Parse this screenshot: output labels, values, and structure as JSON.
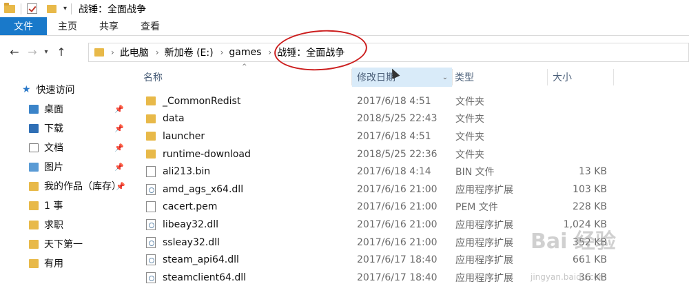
{
  "window": {
    "title": "战锤：全面战争"
  },
  "ribbon": {
    "tabs": [
      "文件",
      "主页",
      "共享",
      "查看"
    ]
  },
  "address": {
    "crumbs": [
      "此电脑",
      "新加卷 (E:)",
      "games",
      "战锤：全面战争"
    ]
  },
  "sidebar": {
    "items": [
      {
        "label": "快速访问",
        "icon": "star-icon"
      },
      {
        "label": "桌面",
        "icon": "desktop-icon",
        "pinned": true
      },
      {
        "label": "下载",
        "icon": "download-icon",
        "pinned": true
      },
      {
        "label": "文档",
        "icon": "document-icon",
        "pinned": true
      },
      {
        "label": "图片",
        "icon": "picture-icon",
        "pinned": true
      },
      {
        "label": "我的作品（库存）",
        "icon": "folder-icon",
        "pinned": true
      },
      {
        "label": "1 事",
        "icon": "folder-icon"
      },
      {
        "label": "求职",
        "icon": "folder-icon"
      },
      {
        "label": "天下第一",
        "icon": "folder-icon"
      },
      {
        "label": "有用",
        "icon": "folder-icon"
      }
    ]
  },
  "columns": {
    "name": "名称",
    "date": "修改日期",
    "type": "类型",
    "size": "大小"
  },
  "files": [
    {
      "name": "_CommonRedist",
      "date": "2017/6/18 4:51",
      "type": "文件夹",
      "size": "",
      "icon": "folder"
    },
    {
      "name": "data",
      "date": "2018/5/25 22:43",
      "type": "文件夹",
      "size": "",
      "icon": "folder"
    },
    {
      "name": "launcher",
      "date": "2017/6/18 4:51",
      "type": "文件夹",
      "size": "",
      "icon": "folder"
    },
    {
      "name": "runtime-download",
      "date": "2018/5/25 22:36",
      "type": "文件夹",
      "size": "",
      "icon": "folder"
    },
    {
      "name": "ali213.bin",
      "date": "2017/6/18 4:14",
      "type": "BIN 文件",
      "size": "13 KB",
      "icon": "doc"
    },
    {
      "name": "amd_ags_x64.dll",
      "date": "2017/6/16 21:00",
      "type": "应用程序扩展",
      "size": "103 KB",
      "icon": "dll"
    },
    {
      "name": "cacert.pem",
      "date": "2017/6/16 21:00",
      "type": "PEM 文件",
      "size": "228 KB",
      "icon": "doc"
    },
    {
      "name": "libeay32.dll",
      "date": "2017/6/16 21:00",
      "type": "应用程序扩展",
      "size": "1,024 KB",
      "icon": "dll"
    },
    {
      "name": "ssleay32.dll",
      "date": "2017/6/16 21:00",
      "type": "应用程序扩展",
      "size": "352 KB",
      "icon": "dll"
    },
    {
      "name": "steam_api64.dll",
      "date": "2017/6/17 18:40",
      "type": "应用程序扩展",
      "size": "661 KB",
      "icon": "dll"
    },
    {
      "name": "steamclient64.dll",
      "date": "2017/6/17 18:40",
      "type": "应用程序扩展",
      "size": "36 KB",
      "icon": "dll"
    }
  ],
  "watermark": {
    "text": "Bai 经验",
    "sub": "jingyan.baidu.com"
  }
}
